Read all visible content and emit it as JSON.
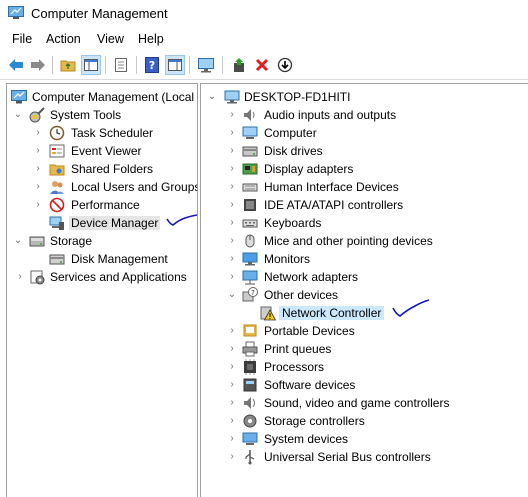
{
  "window": {
    "title": "Computer Management"
  },
  "menu": {
    "file": "File",
    "action": "Action",
    "view": "View",
    "help": "Help"
  },
  "left_tree": {
    "root": "Computer Management (Local",
    "system_tools": "System Tools",
    "task_scheduler": "Task Scheduler",
    "event_viewer": "Event Viewer",
    "shared_folders": "Shared Folders",
    "local_users": "Local Users and Groups",
    "performance": "Performance",
    "device_manager": "Device Manager",
    "storage": "Storage",
    "disk_management": "Disk Management",
    "services": "Services and Applications"
  },
  "right_tree": {
    "root": "DESKTOP-FD1HITI",
    "items": [
      "Audio inputs and outputs",
      "Computer",
      "Disk drives",
      "Display adapters",
      "Human Interface Devices",
      "IDE ATA/ATAPI controllers",
      "Keyboards",
      "Mice and other pointing devices",
      "Monitors",
      "Network adapters",
      "Other devices",
      "Network Controller",
      "Portable Devices",
      "Print queues",
      "Processors",
      "Software devices",
      "Sound, video and game controllers",
      "Storage controllers",
      "System devices",
      "Universal Serial Bus controllers"
    ]
  },
  "colors": {
    "accent": "#0078d7",
    "annotation": "#1515c8",
    "selection": "#cce8ff"
  }
}
